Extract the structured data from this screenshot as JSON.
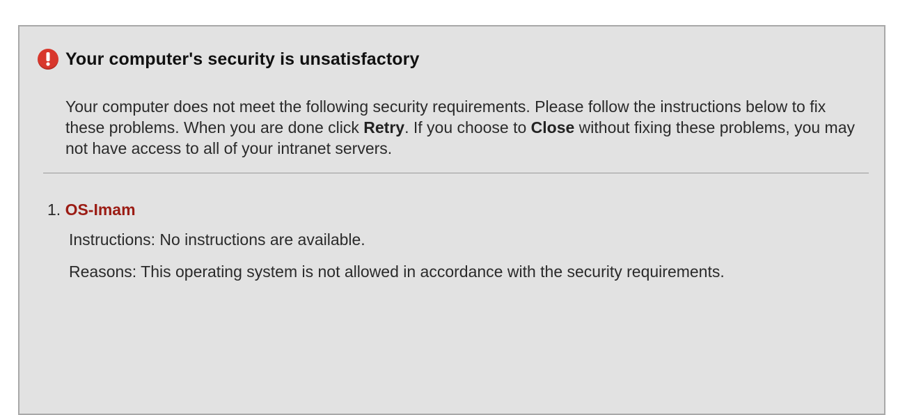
{
  "dialog": {
    "title": "Your computer's security is unsatisfactory",
    "icon": "alert-exclamation-icon",
    "accent_color": "#d8372c",
    "intro": {
      "part1": "Your computer does not meet the following security requirements. Please follow the instructions below to fix these problems. When you are done click ",
      "retry": "Retry",
      "part2": ". If you choose to ",
      "close": "Close",
      "part3": " without fixing these problems, you may not have access to all of your intranet servers."
    },
    "requirements": [
      {
        "number": "1.",
        "name": "OS-Imam",
        "name_color": "#9b1c14",
        "instructions": "Instructions: No instructions are available.",
        "reasons": "Reasons: This operating system is not allowed in accordance with the security requirements."
      }
    ]
  }
}
